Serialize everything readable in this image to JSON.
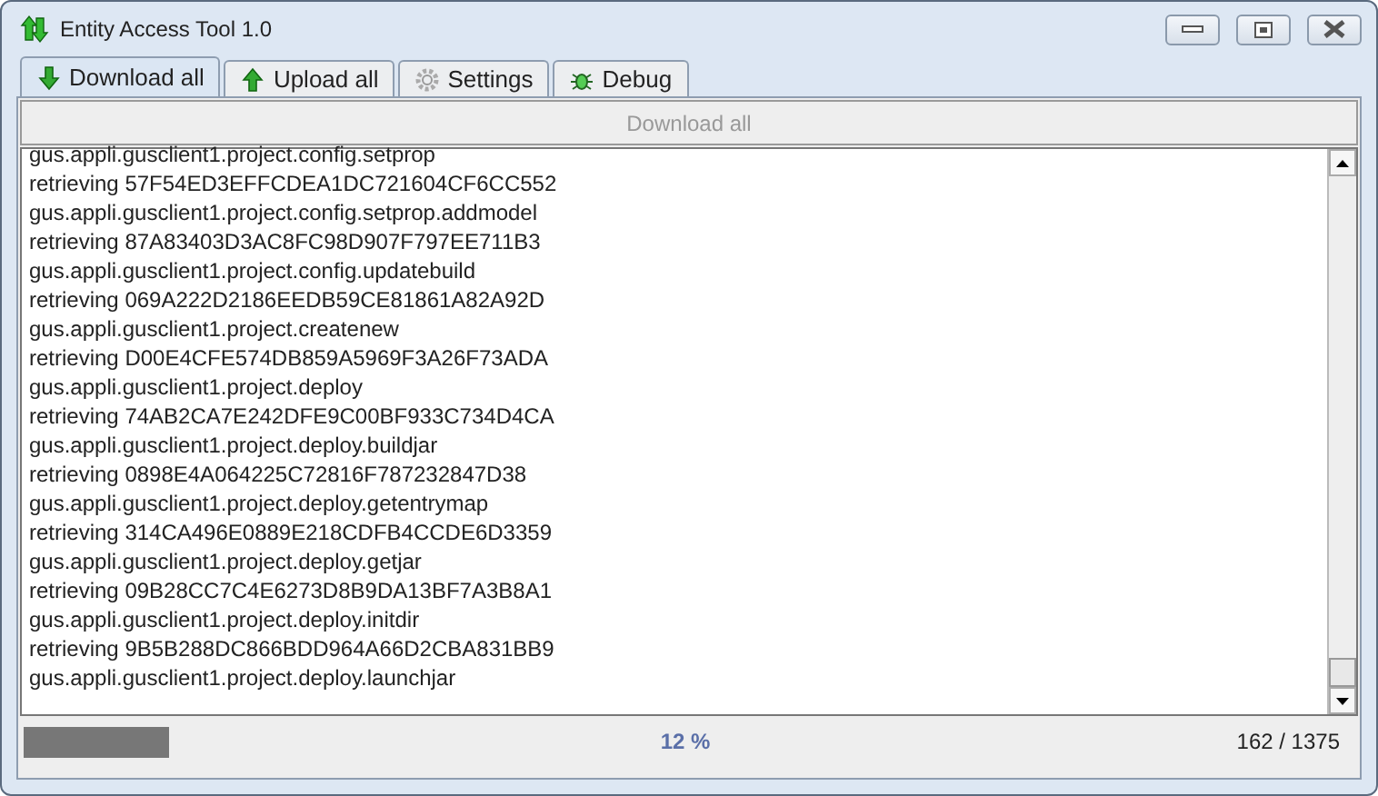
{
  "window": {
    "title": "Entity Access Tool 1.0"
  },
  "tabs": [
    {
      "label": "Download all",
      "kind": "download",
      "selected": true
    },
    {
      "label": "Upload all",
      "kind": "upload",
      "selected": false
    },
    {
      "label": "Settings",
      "kind": "settings",
      "selected": false
    },
    {
      "label": "Debug",
      "kind": "debug",
      "selected": false
    }
  ],
  "action_button": {
    "label": "Download all",
    "disabled": true
  },
  "log": [
    "gus.appli.gusclient1.project.config.setprop",
    "retrieving 57F54ED3EFFCDEA1DC721604CF6CC552",
    "gus.appli.gusclient1.project.config.setprop.addmodel",
    "retrieving 87A83403D3AC8FC98D907F797EE711B3",
    "gus.appli.gusclient1.project.config.updatebuild",
    "retrieving 069A222D2186EEDB59CE81861A82A92D",
    "gus.appli.gusclient1.project.createnew",
    "retrieving D00E4CFE574DB859A5969F3A26F73ADA",
    "gus.appli.gusclient1.project.deploy",
    "retrieving 74AB2CA7E242DFE9C00BF933C734D4CA",
    "gus.appli.gusclient1.project.deploy.buildjar",
    "retrieving 0898E4A064225C72816F787232847D38",
    "gus.appli.gusclient1.project.deploy.getentrymap",
    "retrieving 314CA496E0889E218CDFB4CCDE6D3359",
    "gus.appli.gusclient1.project.deploy.getjar",
    "retrieving 09B28CC7C4E6273D8B9DA13BF7A3B8A1",
    "gus.appli.gusclient1.project.deploy.initdir",
    "retrieving 9B5B288DC866BDD964A66D2CBA831BB9",
    "gus.appli.gusclient1.project.deploy.launchjar"
  ],
  "progress": {
    "level": 0.11,
    "percent": "12 %",
    "count": "162 / 1375"
  }
}
